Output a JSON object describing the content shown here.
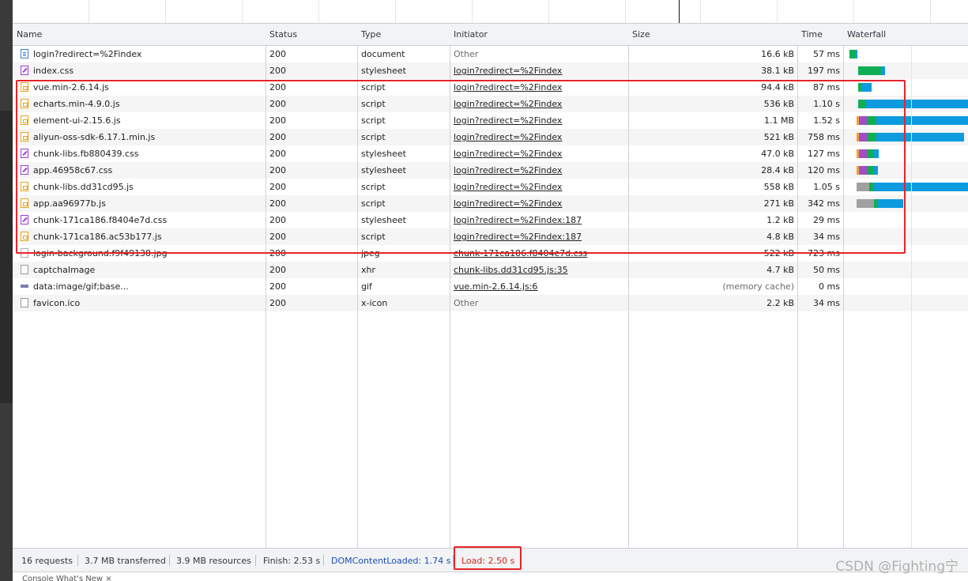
{
  "columns": {
    "name": "Name",
    "status": "Status",
    "type": "Type",
    "initiator": "Initiator",
    "size": "Size",
    "time": "Time",
    "waterfall": "Waterfall"
  },
  "rows": [
    {
      "name": "login?redirect=%2Findex",
      "status": "200",
      "type": "document",
      "initiator": "Other",
      "size": "16.6 kB",
      "time": "57 ms",
      "icon": "document-icon"
    },
    {
      "name": "index.css",
      "status": "200",
      "type": "stylesheet",
      "initiator": "login?redirect=%2Findex",
      "size": "38.1 kB",
      "time": "197 ms",
      "icon": "stylesheet-icon"
    },
    {
      "name": "vue.min-2.6.14.js",
      "status": "200",
      "type": "script",
      "initiator": "login?redirect=%2Findex",
      "size": "94.4 kB",
      "time": "87 ms",
      "icon": "script-icon"
    },
    {
      "name": "echarts.min-4.9.0.js",
      "status": "200",
      "type": "script",
      "initiator": "login?redirect=%2Findex",
      "size": "536 kB",
      "time": "1.10 s",
      "icon": "script-icon"
    },
    {
      "name": "element-ui-2.15.6.js",
      "status": "200",
      "type": "script",
      "initiator": "login?redirect=%2Findex",
      "size": "1.1 MB",
      "time": "1.52 s",
      "icon": "script-icon"
    },
    {
      "name": "aliyun-oss-sdk-6.17.1.min.js",
      "status": "200",
      "type": "script",
      "initiator": "login?redirect=%2Findex",
      "size": "521 kB",
      "time": "758 ms",
      "icon": "script-icon"
    },
    {
      "name": "chunk-libs.fb880439.css",
      "status": "200",
      "type": "stylesheet",
      "initiator": "login?redirect=%2Findex",
      "size": "47.0 kB",
      "time": "127 ms",
      "icon": "stylesheet-icon"
    },
    {
      "name": "app.46958c67.css",
      "status": "200",
      "type": "stylesheet",
      "initiator": "login?redirect=%2Findex",
      "size": "28.4 kB",
      "time": "120 ms",
      "icon": "stylesheet-icon"
    },
    {
      "name": "chunk-libs.dd31cd95.js",
      "status": "200",
      "type": "script",
      "initiator": "login?redirect=%2Findex",
      "size": "558 kB",
      "time": "1.05 s",
      "icon": "script-icon"
    },
    {
      "name": "app.aa96977b.js",
      "status": "200",
      "type": "script",
      "initiator": "login?redirect=%2Findex",
      "size": "271 kB",
      "time": "342 ms",
      "icon": "script-icon"
    },
    {
      "name": "chunk-171ca186.f8404e7d.css",
      "status": "200",
      "type": "stylesheet",
      "initiator": "login?redirect=%2Findex:187",
      "size": "1.2 kB",
      "time": "29 ms",
      "icon": "stylesheet-icon"
    },
    {
      "name": "chunk-171ca186.ac53b177.js",
      "status": "200",
      "type": "script",
      "initiator": "login?redirect=%2Findex:187",
      "size": "4.8 kB",
      "time": "34 ms",
      "icon": "script-icon"
    },
    {
      "name": "login-background.f9f49138.jpg",
      "status": "200",
      "type": "jpeg",
      "initiator": "chunk-171ca186.f8404e7d.css",
      "size": "522 kB",
      "time": "723 ms",
      "icon": "image-icon"
    },
    {
      "name": "captchaImage",
      "status": "200",
      "type": "xhr",
      "initiator": "chunk-libs.dd31cd95.js:35",
      "size": "4.7 kB",
      "time": "50 ms",
      "icon": "blank-file-icon"
    },
    {
      "name": "data:image/gif;base...",
      "status": "200",
      "type": "gif",
      "initiator": "vue.min-2.6.14.js:6",
      "size": "(memory cache)",
      "time": "0 ms",
      "icon": "gif-icon"
    },
    {
      "name": "favicon.ico",
      "status": "200",
      "type": "x-icon",
      "initiator": "Other",
      "size": "2.2 kB",
      "time": "34 ms",
      "icon": "blank-file-icon"
    }
  ],
  "statusbar": {
    "requests": "16 requests",
    "transferred": "3.7 MB transferred",
    "resources": "3.9 MB resources",
    "finish": "Finish: 2.53 s",
    "dom_content_loaded": "DOMContentLoaded: 1.74 s",
    "load": "Load: 2.50 s"
  },
  "drawer": {
    "tabs_text": "Console   What's New  ×"
  },
  "watermark": "CSDN @Fighting宁",
  "colors": {
    "waiting": "#0fae54",
    "download": "#0d9be0",
    "queue": "#a0a0a0",
    "highlight": "#e8242a",
    "dcl": "#1a4fb5",
    "load": "#d0271d"
  }
}
